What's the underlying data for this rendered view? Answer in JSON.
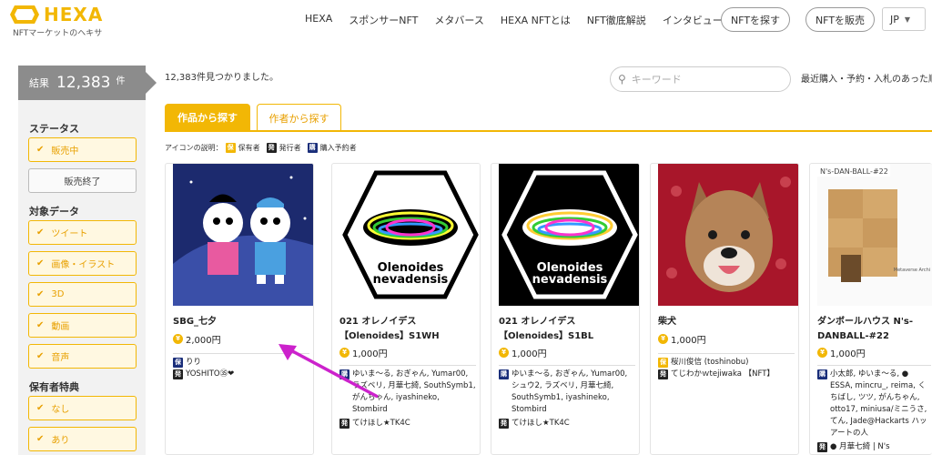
{
  "header": {
    "logo_text": "HEXA",
    "logo_sub": "NFTマーケットのヘキサ",
    "nav": [
      "HEXA",
      "スポンサーNFT",
      "メタバース",
      "HEXA NFTとは",
      "NFT徹底解説",
      "インタビュー"
    ],
    "find_btn": "NFTを探す",
    "sell_btn": "NFTを販売",
    "lang": "JP"
  },
  "sidebar": {
    "result_label": "結果",
    "result_count": "12,383",
    "result_unit": "件",
    "status_head": "ステータス",
    "status_on_sale": "販売中",
    "status_ended": "販売終了",
    "target_head": "対象データ",
    "targets": [
      "ツイート",
      "画像・イラスト",
      "3D",
      "動画",
      "音声"
    ],
    "holder_head": "保有者特典",
    "holder_none": "なし",
    "holder_yes": "あり"
  },
  "main": {
    "found_text": "12,383件見つかりました。",
    "search_placeholder": "キーワード",
    "sort_label": "最近購入・予約・入札のあった順",
    "tab_works": "作品から探す",
    "tab_authors": "作者から探す",
    "legend_title": "アイコンの説明：",
    "legend_owner": "保有者",
    "legend_issuer": "発行者",
    "legend_reserver": "購入予約者",
    "badge_owner": "保",
    "badge_issuer": "発",
    "badge_reserver": "購"
  },
  "cards": [
    {
      "title": "SBG_七夕",
      "price": "2,000円",
      "owner": "りり",
      "issuer": "YOSHITO㉟❤"
    },
    {
      "title": "021 オレノイデス【Olenoides】S1WH",
      "img_text1": "Olenoides",
      "img_text2": "nevadensis",
      "price": "1,000円",
      "reservers": "ゆいま〜る, おぎゃん, Yumar00, ラズベリ, 月華七綺, SouthSymb1, がんちゃん, iyashineko, Stombird",
      "issuer": "てけほし★TK4C"
    },
    {
      "title": "021 オレノイデス【Olenoides】S1BL",
      "img_text1": "Olenoides",
      "img_text2": "nevadensis",
      "price": "1,000円",
      "reservers": "ゆいま〜る, おぎゃん, Yumar00, シュウ2, ラズベリ, 月華七綺, SouthSymb1, iyashineko, Stombird",
      "issuer": "てけほし★TK4C"
    },
    {
      "title": "柴犬",
      "price": "1,000円",
      "owner": "桜川俊信 (toshinobu)",
      "issuer": "てじわかｗtejiwaka 【NFT】"
    },
    {
      "title": "ダンボールハウス N's-DANBALL-#22",
      "img_label": "N's-DAN-BALL-#22",
      "img_side": "Metaverse Archi",
      "price": "1,000円",
      "reservers": "小太郎, ゆいま〜る, ● ESSA, mincru_, reima, くちばし, ツツ, がんちゃん, otto17, miniusa/ミニうさ, てん, Jade@Hackarts ハッ アートの人",
      "issuer": "● 月華七綺 | N's Metaverse Architect"
    }
  ],
  "colors": {
    "accent": "#f2b705",
    "sidebar_bg": "#f2f2f2",
    "result_bg": "#8c8c8c",
    "annotation_arrow": "#cc22cc"
  }
}
